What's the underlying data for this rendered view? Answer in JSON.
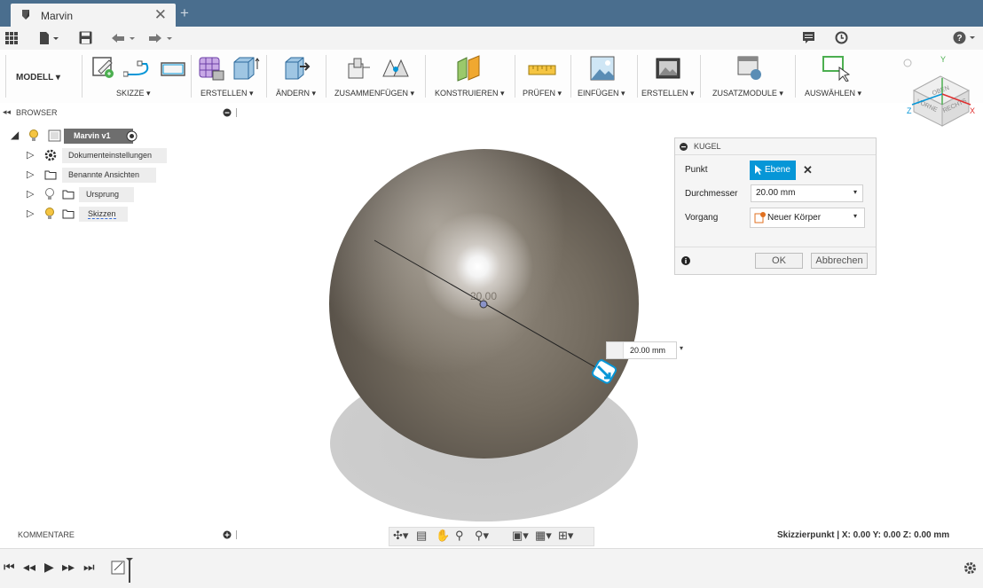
{
  "window": {
    "tab_title": "Marvin",
    "close_glyph": "✕",
    "newtab_glyph": "+"
  },
  "ribbon": {
    "modell": "MODELL ▾",
    "groups": [
      "SKIZZE ▾",
      "ERSTELLEN ▾",
      "ÄNDERN ▾",
      "ZUSAMMENFÜGEN ▾",
      "KONSTRUIEREN ▾",
      "PRÜFEN ▾",
      "EINFÜGEN ▾",
      "ERSTELLEN ▾",
      "ZUSATZMODULE ▾",
      "AUSWÄHLEN ▾"
    ]
  },
  "viewcube": {
    "top": "OBEN",
    "front": "VORNE",
    "right": "RECHTS",
    "x": "X",
    "y": "Y",
    "z": "Z"
  },
  "browser": {
    "title": "BROWSER",
    "root": "Marvin v1",
    "items": [
      "Dokumenteinstellungen",
      "Benannte Ansichten",
      "Ursprung",
      "Skizzen"
    ]
  },
  "dialog": {
    "title": "KUGEL",
    "punkt_label": "Punkt",
    "punkt_value": "Ebene",
    "durchmesser_label": "Durchmesser",
    "durchmesser_value": "20.00 mm",
    "vorgang_label": "Vorgang",
    "vorgang_value": "Neuer Körper",
    "ok": "OK",
    "cancel": "Abbrechen"
  },
  "viewport": {
    "dim_label": "20.00",
    "dim_input": "20.00 mm"
  },
  "comments": {
    "title": "KOMMENTARE"
  },
  "status": {
    "text": "Skizzierpunkt | X: 0.00 Y: 0.00 Z: 0.00 mm"
  },
  "colors": {
    "accent": "#0696d7",
    "titlebar": "#4a6e8e"
  }
}
